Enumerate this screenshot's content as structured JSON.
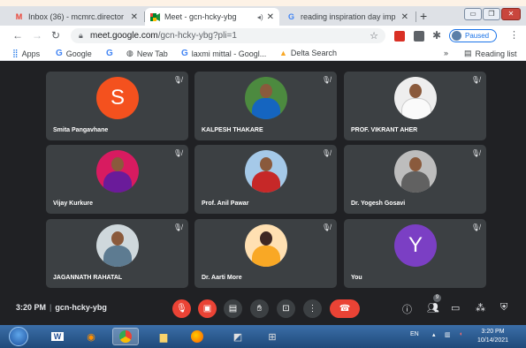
{
  "browser": {
    "tabs": [
      {
        "title": "Inbox (36) - mcmrc.director",
        "icon": "gmail-icon",
        "active": false
      },
      {
        "title": "Meet - gcn-hcky-ybg",
        "icon": "meet-icon",
        "active": true
      },
      {
        "title": "reading inspiration day imp",
        "icon": "google-icon",
        "active": false
      }
    ],
    "new_tab_symbol": "+",
    "url_host": "meet.google.com",
    "url_path": "/gcn-hcky-ybg?pli=1",
    "profile_status": "Paused",
    "bookmarks": [
      {
        "label": "Apps",
        "icon": "apps-grid-icon"
      },
      {
        "label": "Google",
        "icon": "google-icon"
      },
      {
        "label": "",
        "icon": "google-icon"
      },
      {
        "label": "New Tab",
        "icon": "globe-icon"
      },
      {
        "label": "laxmi mittal - Googl...",
        "icon": "google-icon"
      },
      {
        "label": "Delta Search",
        "icon": "delta-icon"
      }
    ],
    "bookmarks_more": "»",
    "reading_list": "Reading list"
  },
  "meet": {
    "participants": [
      {
        "name": "Smita Pangavhane",
        "avatar_type": "letter",
        "letter": "S",
        "color": "#f4511e"
      },
      {
        "name": "KALPESH THAKARE",
        "avatar_type": "photo",
        "color": "#2e7d32"
      },
      {
        "name": "PROF. VIKRANT AHER",
        "avatar_type": "photo",
        "color": "#eeeeee"
      },
      {
        "name": "Vijay Kurkure",
        "avatar_type": "photo",
        "color": "#c2185b"
      },
      {
        "name": "Prof. Anil Pawar",
        "avatar_type": "photo",
        "color": "#1565c0"
      },
      {
        "name": "Dr. Yogesh Gosavi",
        "avatar_type": "photo",
        "color": "#9e9e9e"
      },
      {
        "name": "JAGANNATH RAHATAL",
        "avatar_type": "photo",
        "color": "#5d7b91"
      },
      {
        "name": "Dr. Aarti More",
        "avatar_type": "photo",
        "color": "#f9a825"
      },
      {
        "name": "You",
        "avatar_type": "letter",
        "letter": "Y",
        "color": "#7b3fc4"
      }
    ],
    "time": "3:20 PM",
    "meeting_code": "gcn-hcky-ybg",
    "people_count": "9"
  },
  "taskbar": {
    "lang": "EN",
    "time": "3:20 PM",
    "date": "10/14/2021"
  }
}
